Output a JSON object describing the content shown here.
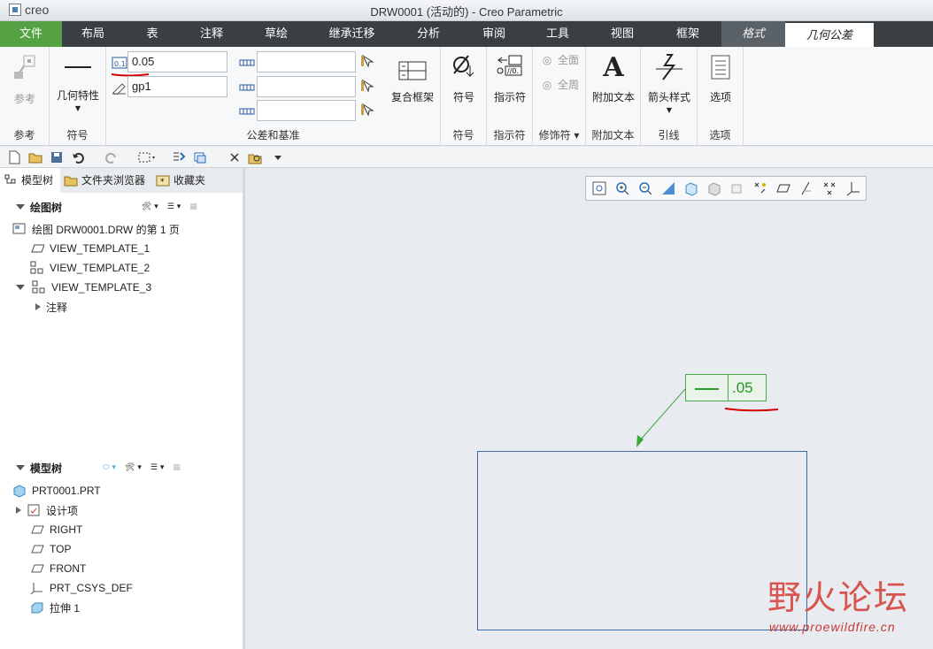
{
  "app": {
    "logo_text": "creo",
    "window_title": "DRW0001 (活动的) - Creo Parametric"
  },
  "menu": {
    "items": [
      "文件",
      "布局",
      "表",
      "注释",
      "草绘",
      "继承迁移",
      "分析",
      "审阅",
      "工具",
      "视图",
      "框架",
      "格式",
      "几何公差"
    ]
  },
  "ribbon": {
    "groups": {
      "reference": {
        "button": "参考",
        "label": "参考"
      },
      "symbol_group": {
        "button": "几何特性",
        "label": "符号"
      },
      "tolerance": {
        "label": "公差和基准",
        "value": "0.05",
        "name_value": "gp1",
        "datum1": "",
        "datum2": "",
        "datum3": ""
      },
      "composite": {
        "button": "复合框架"
      },
      "symbol2": {
        "button": "符号",
        "label": "符号"
      },
      "indicator": {
        "button": "指示符",
        "label": "指示符"
      },
      "modifier": {
        "all_around1": "全面",
        "all_around2": "全周",
        "label": "修饰符"
      },
      "additional_text": {
        "button": "附加文本",
        "label": "附加文本"
      },
      "leader": {
        "button": "箭头样式",
        "label": "引线"
      },
      "options": {
        "button": "选项",
        "label": "选项"
      }
    }
  },
  "left_panel": {
    "tabs": [
      "模型树",
      "文件夹浏览器",
      "收藏夹"
    ],
    "drawing_tree": {
      "title": "绘图树",
      "items": [
        "绘图 DRW0001.DRW 的第 1 页",
        "VIEW_TEMPLATE_1",
        "VIEW_TEMPLATE_2",
        "VIEW_TEMPLATE_3",
        "注释"
      ]
    },
    "model_tree": {
      "title": "模型树",
      "items": [
        "PRT0001.PRT",
        "设计项",
        "RIGHT",
        "TOP",
        "FRONT",
        "PRT_CSYS_DEF",
        "拉伸 1"
      ]
    }
  },
  "canvas": {
    "gtol_value": ".05",
    "colors": {
      "gtol": "#2e9a2e",
      "frame": "#3b6aa6",
      "annotation_mark": "#d40000"
    }
  },
  "watermark": {
    "cn": "野火论坛",
    "en": "www.proewildfire.cn"
  }
}
